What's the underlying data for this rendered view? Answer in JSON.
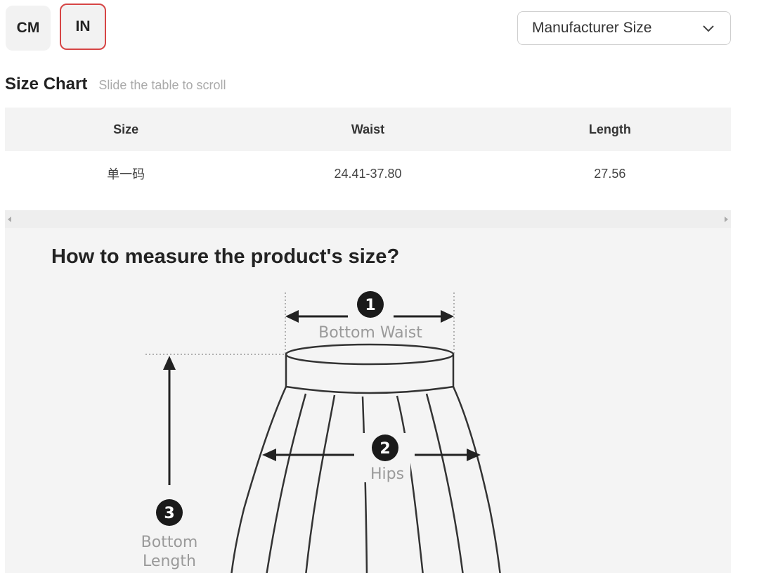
{
  "units": {
    "options": [
      {
        "label": "CM",
        "selected": false
      },
      {
        "label": "IN",
        "selected": true
      }
    ],
    "selected_border_color": "#d64545"
  },
  "size_system": {
    "selected": "Manufacturer Size",
    "icon": "chevron-down-icon"
  },
  "size_chart": {
    "title": "Size Chart",
    "hint": "Slide the table to scroll",
    "columns": [
      "Size",
      "Waist",
      "Length"
    ],
    "rows": [
      [
        "单一码",
        "24.41-37.80",
        "27.56"
      ]
    ]
  },
  "scrollbar": {
    "left_icon": "arrow-left-icon",
    "right_icon": "arrow-right-icon"
  },
  "measure_guide": {
    "title": "How to measure the product's size?",
    "steps": [
      {
        "number": "1",
        "label": "Bottom Waist"
      },
      {
        "number": "2",
        "label": "Hips"
      },
      {
        "number": "3",
        "label_lines": [
          "Bottom",
          "Length"
        ]
      }
    ]
  }
}
